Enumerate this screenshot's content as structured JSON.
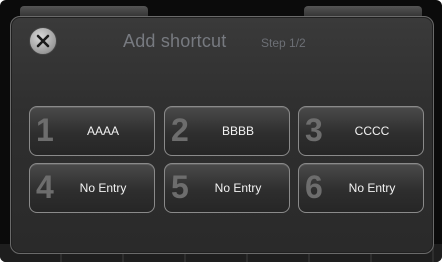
{
  "dialog": {
    "title": "Add shortcut",
    "step": "Step 1/2",
    "close_icon": "close-icon"
  },
  "slots": [
    {
      "number": "1",
      "label": "AAAA"
    },
    {
      "number": "2",
      "label": "BBBB"
    },
    {
      "number": "3",
      "label": "CCCC"
    },
    {
      "number": "4",
      "label": "No Entry"
    },
    {
      "number": "5",
      "label": "No Entry"
    },
    {
      "number": "6",
      "label": "No Entry"
    }
  ],
  "colors": {
    "background": "#0b0b0b",
    "dialog": "#2f2f2f",
    "tile_border": "#8a8a8a",
    "label_text": "#f2f2f2",
    "number_text": "#6d6d6d",
    "title_text": "#777a80"
  }
}
